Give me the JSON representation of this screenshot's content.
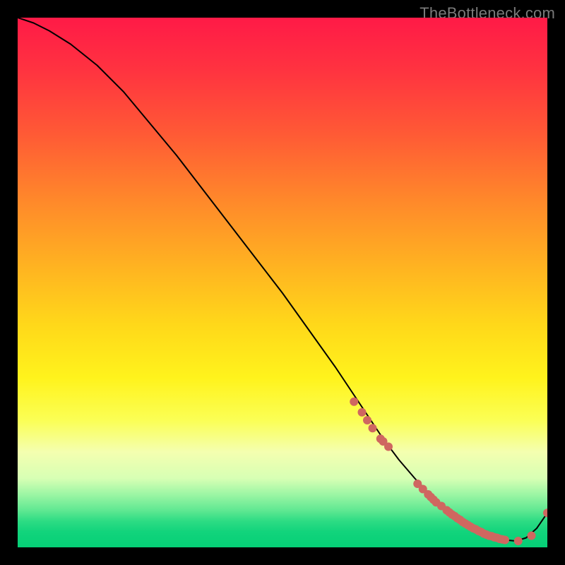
{
  "watermark": "TheBottleneck.com",
  "chart_data": {
    "type": "line",
    "title": "",
    "xlabel": "",
    "ylabel": "",
    "xlim": [
      0,
      100
    ],
    "ylim": [
      0,
      100
    ],
    "grid": false,
    "legend": false,
    "series": [
      {
        "name": "curve",
        "style": "line",
        "color": "#000000",
        "x": [
          0,
          3,
          6,
          10,
          15,
          20,
          25,
          30,
          35,
          40,
          45,
          50,
          55,
          60,
          63,
          66,
          69,
          72,
          75,
          78,
          80,
          82,
          84,
          86,
          88,
          90,
          92,
          94,
          96,
          98,
          100
        ],
        "y": [
          100,
          99,
          97.5,
          95,
          91,
          86,
          80,
          74,
          67.5,
          61,
          54.5,
          48,
          41,
          34,
          29.5,
          25,
          20.5,
          16.5,
          13,
          9.8,
          7.8,
          6.2,
          4.8,
          3.6,
          2.6,
          1.9,
          1.4,
          1.2,
          1.8,
          3.6,
          6.5
        ]
      },
      {
        "name": "markers",
        "style": "scatter",
        "color": "#cf6760",
        "x": [
          63.5,
          65,
          66,
          67,
          68.5,
          69,
          70,
          75.5,
          76.5,
          77.5,
          78,
          78.5,
          79,
          80,
          81,
          81.5,
          82,
          82.5,
          83,
          83.5,
          84,
          84.5,
          85,
          85.5,
          86,
          86.5,
          87,
          87.5,
          88,
          88.5,
          89,
          89.5,
          90,
          90.5,
          91,
          91.5,
          92,
          94.5,
          97,
          100
        ],
        "y": [
          27.5,
          25.5,
          24,
          22.5,
          20.5,
          20,
          19,
          12,
          11,
          10,
          9.5,
          9,
          8.5,
          7.8,
          7,
          6.6,
          6.2,
          5.9,
          5.5,
          5.2,
          4.8,
          4.5,
          4.2,
          3.9,
          3.6,
          3.4,
          3.1,
          2.9,
          2.6,
          2.4,
          2.2,
          2.1,
          1.9,
          1.8,
          1.6,
          1.5,
          1.4,
          1.2,
          2.2,
          6.5
        ]
      }
    ]
  }
}
